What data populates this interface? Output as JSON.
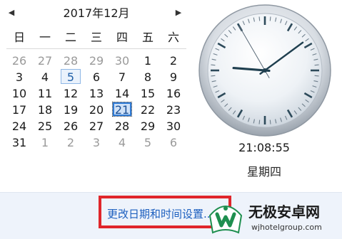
{
  "calendar": {
    "prev_label": "◀",
    "next_label": "▶",
    "month_title": "2017年12月",
    "weekdays": [
      "日",
      "一",
      "二",
      "三",
      "四",
      "五",
      "六"
    ],
    "weeks": [
      [
        {
          "d": "26",
          "other": true
        },
        {
          "d": "27",
          "other": true
        },
        {
          "d": "28",
          "other": true
        },
        {
          "d": "29",
          "other": true
        },
        {
          "d": "30",
          "other": true
        },
        {
          "d": "1"
        },
        {
          "d": "2"
        }
      ],
      [
        {
          "d": "3"
        },
        {
          "d": "4"
        },
        {
          "d": "5",
          "today": true
        },
        {
          "d": "6"
        },
        {
          "d": "7"
        },
        {
          "d": "8"
        },
        {
          "d": "9"
        }
      ],
      [
        {
          "d": "10"
        },
        {
          "d": "11"
        },
        {
          "d": "12"
        },
        {
          "d": "13"
        },
        {
          "d": "14"
        },
        {
          "d": "15"
        },
        {
          "d": "16"
        }
      ],
      [
        {
          "d": "17"
        },
        {
          "d": "18"
        },
        {
          "d": "19"
        },
        {
          "d": "20"
        },
        {
          "d": "21",
          "selected": true
        },
        {
          "d": "22"
        },
        {
          "d": "23"
        }
      ],
      [
        {
          "d": "24"
        },
        {
          "d": "25"
        },
        {
          "d": "26"
        },
        {
          "d": "27"
        },
        {
          "d": "28"
        },
        {
          "d": "29"
        },
        {
          "d": "30"
        }
      ],
      [
        {
          "d": "31"
        },
        {
          "d": "1",
          "other": true
        },
        {
          "d": "2",
          "other": true
        },
        {
          "d": "3",
          "other": true
        },
        {
          "d": "4",
          "other": true
        },
        {
          "d": "5",
          "other": true
        },
        {
          "d": "6",
          "other": true
        }
      ]
    ]
  },
  "clock": {
    "time": "21:08:55",
    "weekday": "星期四",
    "hour": 21,
    "minute": 8,
    "second": 55
  },
  "footer": {
    "change_datetime_link": "更改日期和时间设置..."
  },
  "watermark": {
    "brand": "无极安卓网",
    "domain": "wjhotelgroup.com"
  },
  "colors": {
    "link": "#1c5fbf",
    "highlight": "#e0262b",
    "selected_day": "#2f7bd6",
    "footer_bg": "#eef3fb"
  }
}
